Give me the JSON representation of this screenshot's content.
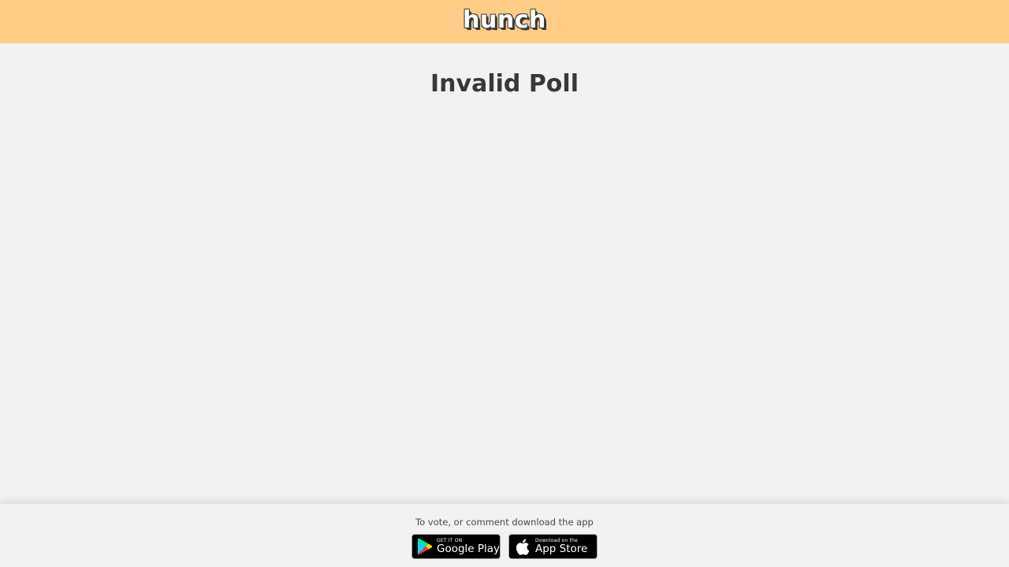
{
  "header": {
    "logo_text": "hunch",
    "background_color": "#ffcd87"
  },
  "main": {
    "title": "Invalid Poll"
  },
  "footer": {
    "prompt": "To vote, or comment download the app",
    "google_play": {
      "small_label": "GET IT ON",
      "big_label": "Google Play",
      "icon": "google-play-icon"
    },
    "app_store": {
      "small_label": "Download on the",
      "big_label": "App Store",
      "icon": "apple-icon"
    }
  }
}
